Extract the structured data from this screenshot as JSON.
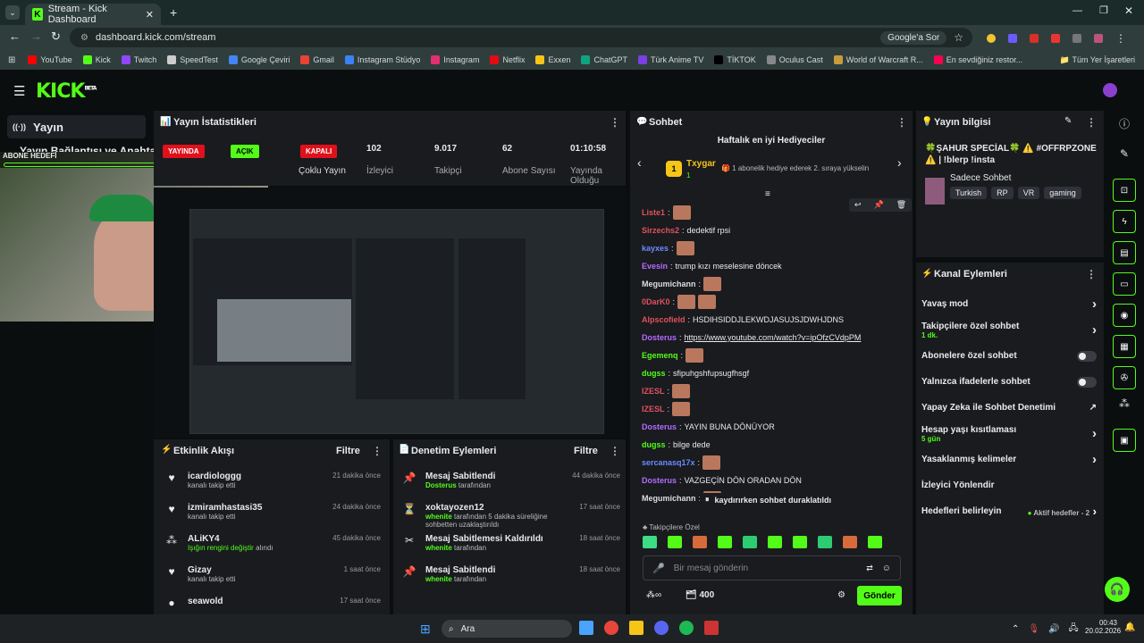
{
  "browser": {
    "tab_title": "Stream - Kick Dashboard",
    "url": "dashboard.kick.com/stream",
    "google_btn": "Google'a Sor",
    "all_bookmarks": "Tüm Yer İşaretleri",
    "bookmarks": [
      "YouTube",
      "Kick",
      "Twitch",
      "SpeedTest",
      "Google Çeviri",
      "Gmail",
      "Instagram Stüdyo",
      "Instagram",
      "Netflix",
      "Exxen",
      "ChatGPT",
      "Türk Anime TV",
      "TİKTOK",
      "Oculus Cast",
      "World of Warcraft R...",
      "En sevdiğiniz restor..."
    ],
    "bookmark_colors": [
      "#ff0000",
      "#53fc18",
      "#9146ff",
      "#cccccc",
      "#4285f4",
      "#ea4335",
      "#3b82f6",
      "#e1306c",
      "#e50914",
      "#f5c518",
      "#10a37f",
      "#7b3fe4",
      "#000000",
      "#888888",
      "#c89b3c",
      "#fa0050"
    ]
  },
  "kick": {
    "logo": "KICK",
    "beta": "BETA"
  },
  "left": {
    "yayin": "Yayın",
    "baglanti": "Yayın Bağlantısı ve Anahtarı",
    "abone_hedefi": "ABONE HEDEFİ"
  },
  "stats": {
    "title": "Yayın İstatistikleri",
    "live_badge": "YAYINDA",
    "acik_badge": "AÇIK",
    "kapali_badge": "KAPALI",
    "coklu": "Çoklu Yayın",
    "items": [
      {
        "v": "102",
        "l": "İzleyici"
      },
      {
        "v": "9.017",
        "l": "Takipçi"
      },
      {
        "v": "62",
        "l": "Abone Sayısı"
      },
      {
        "v": "01:10:58",
        "l": "Yayında Olduğu"
      }
    ]
  },
  "activity": {
    "title": "Etkinlik Akışı",
    "filter": "Filtre",
    "items": [
      {
        "n": "icardiologgg",
        "s": "kanalı takip etti",
        "t": "21 dakika önce",
        "g": ""
      },
      {
        "n": "izmiramhastasi35",
        "s": "kanalı takip etti",
        "t": "24 dakika önce",
        "g": ""
      },
      {
        "n": "ALiKY4",
        "s": "alındı",
        "t": "45 dakika önce",
        "g": "Işığın rengini değiştir"
      },
      {
        "n": "Gizay",
        "s": "kanalı takip etti",
        "t": "1 saat önce",
        "g": ""
      },
      {
        "n": "seawold",
        "s": "",
        "t": "17 saat önce",
        "g": ""
      }
    ]
  },
  "moderation": {
    "title": "Denetim Eylemleri",
    "filter": "Filtre",
    "items": [
      {
        "n": "Mesaj Sabitlendi",
        "u": "Dosterus",
        "s": "tarafından",
        "t": "44 dakika önce"
      },
      {
        "n": "xoktayozen12",
        "u": "whenite",
        "s": "tarafından 5 dakika süreliğine sohbetten uzaklaştırıldı",
        "t": "17 saat önce"
      },
      {
        "n": "Mesaj Sabitlemesi Kaldırıldı",
        "u": "whenite",
        "s": "tarafından",
        "t": "18 saat önce"
      },
      {
        "n": "Mesaj Sabitlendi",
        "u": "whenite",
        "s": "tarafından",
        "t": "18 saat önce"
      }
    ]
  },
  "chat": {
    "title": "Sohbet",
    "gifters_title": "Haftalık en iyi Hediyeciler",
    "top_gifter": "Txygar",
    "top_gifter_count": "1",
    "gifter_hint": "1 abonelik hediye ederek 2. sıraya yükselin",
    "lines": [
      {
        "u": "Liste1",
        "c": "#e0525c",
        "m": "",
        "e": 1
      },
      {
        "u": "Sirzechs2",
        "c": "#e0525c",
        "m": "dedektif rpsi",
        "e": 0
      },
      {
        "u": "kayxes",
        "c": "#6b8cff",
        "m": "",
        "e": 1
      },
      {
        "u": "Evesin",
        "c": "#b46bff",
        "m": "trump kızı meselesine döncek",
        "e": 0
      },
      {
        "u": "Megumichann",
        "c": "#ddd",
        "m": "",
        "e": 1
      },
      {
        "u": "0DarK0",
        "c": "#e0525c",
        "m": "",
        "e": 2
      },
      {
        "u": "Alpscofield",
        "c": "#e0525c",
        "m": "HSDIHSIDDJLEKWDJASUJSJDWHJDNS",
        "e": 0
      },
      {
        "u": "Dosterus",
        "c": "#b46bff",
        "m": "https://www.youtube.com/watch?v=ipOfzCVdpPM",
        "e": 0
      },
      {
        "u": "Egemenq",
        "c": "#53fc18",
        "m": "",
        "e": 1
      },
      {
        "u": "dugss",
        "c": "#53fc18",
        "m": "sfipuhgshfupsugfhsgf",
        "e": 0
      },
      {
        "u": "IZESL",
        "c": "#e0525c",
        "m": "",
        "e": 1
      },
      {
        "u": "IZESL",
        "c": "#e0525c",
        "m": "",
        "e": 1
      },
      {
        "u": "Dosterus",
        "c": "#b46bff",
        "m": "YAYIN BUNA DÖNÜYOR",
        "e": 0
      },
      {
        "u": "dugss",
        "c": "#53fc18",
        "m": "bilge dede",
        "e": 0
      },
      {
        "u": "sercanasq17x",
        "c": "#6b8cff",
        "m": "",
        "e": 1
      },
      {
        "u": "Dosterus",
        "c": "#b46bff",
        "m": "VAZGEÇİN DÖN ORADAN DÖN",
        "e": 0
      },
      {
        "u": "Megumichann",
        "c": "#ddd",
        "m": "",
        "e": 1
      }
    ],
    "paused": "kaydırırken sohbet duraklatıldı",
    "followers_only": "Takipçilere Özel",
    "input_placeholder": "Bir mesaj gönderin",
    "points": "400",
    "send": "Gönder"
  },
  "info": {
    "title": "Yayın bilgisi",
    "stream_title": "🍀ŞAHUR SPECİAL🍀 ⚠️ #OFFRPZONE ⚠️ | !blerp !insta",
    "category": "Sadece Sohbet",
    "tags": [
      "Turkish",
      "RP",
      "VR",
      "gaming"
    ]
  },
  "channel": {
    "title": "Kanal Eylemleri",
    "items": [
      {
        "l": "Yavaş mod",
        "s": "",
        "k": "arrow"
      },
      {
        "l": "Takipçilere özel sohbet",
        "s": "1 dk.",
        "k": "arrow"
      },
      {
        "l": "Abonelere özel sohbet",
        "s": "",
        "k": "toggle"
      },
      {
        "l": "Yalnızca ifadelerle sohbet",
        "s": "",
        "k": "toggle"
      },
      {
        "l": "Yapay Zeka ile Sohbet Denetimi",
        "s": "",
        "k": "ext"
      },
      {
        "l": "Hesap yaşı kısıtlaması",
        "s": "5 gün",
        "k": "arrow"
      },
      {
        "l": "Yasaklanmış kelimeler",
        "s": "",
        "k": "arrow"
      },
      {
        "l": "İzleyici Yönlendir",
        "s": "",
        "k": "none"
      },
      {
        "l": "Hedefleri belirleyin",
        "s": "",
        "k": "goal"
      }
    ],
    "goal_status": "Aktif hedefler - 2"
  },
  "taskbar": {
    "search": "Ara",
    "time": "00:43",
    "date": "20.02.2026"
  }
}
